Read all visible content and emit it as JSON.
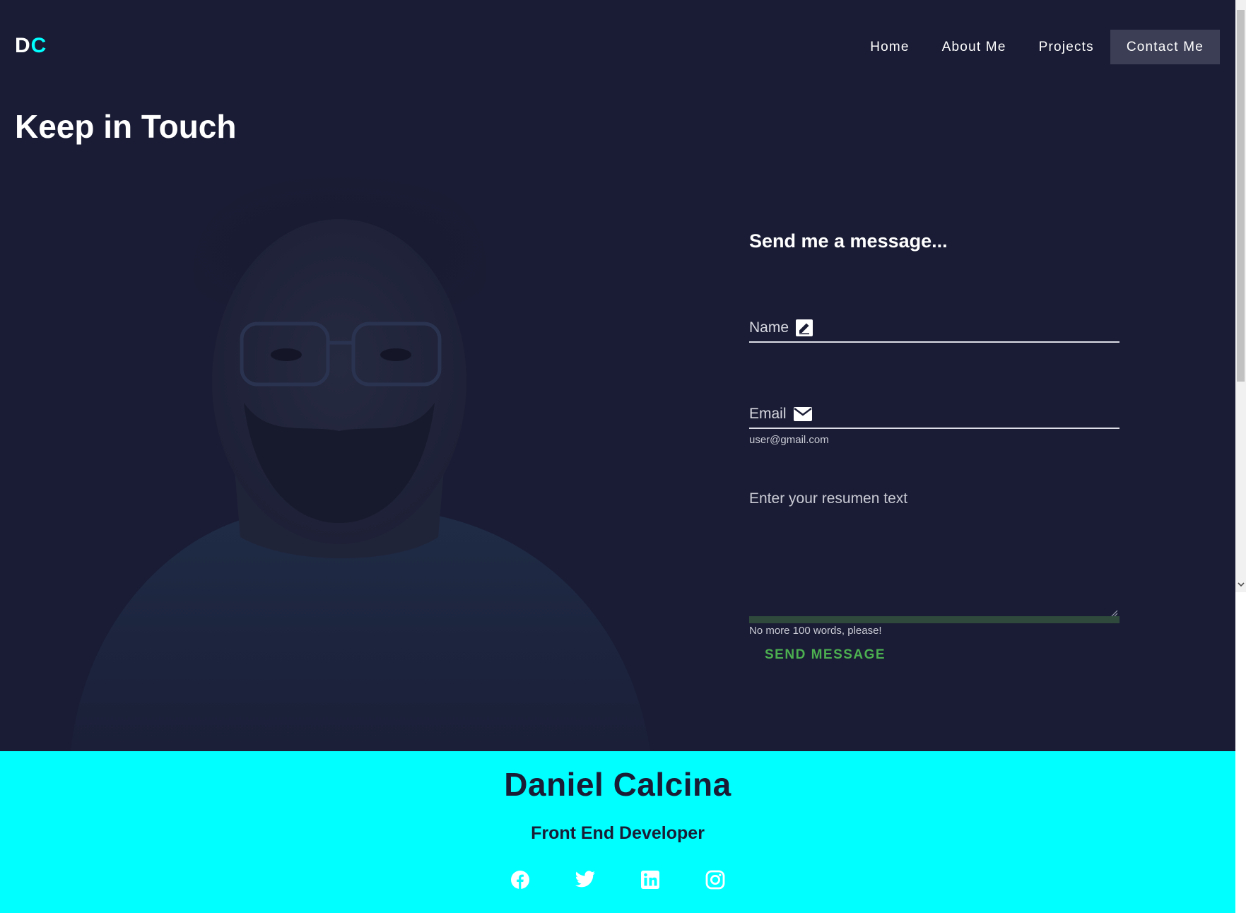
{
  "brand": {
    "first": "D",
    "second": "C"
  },
  "nav": {
    "items": [
      {
        "label": "Home"
      },
      {
        "label": "About Me"
      },
      {
        "label": "Projects"
      },
      {
        "label": "Contact Me",
        "active": true
      }
    ]
  },
  "page_title": "Keep in Touch",
  "form": {
    "title": "Send me a message...",
    "name_label": "Name",
    "name_icon": "edit-icon",
    "email_label": "Email",
    "email_icon": "mail-icon",
    "email_hint": "user@gmail.com",
    "message_label": "Enter your resumen text",
    "message_hint": "No more 100 words, please!",
    "send_label": "SEND MESSAGE"
  },
  "footer": {
    "name": "Daniel Calcina",
    "role": "Front End Developer",
    "socials": [
      "facebook-icon",
      "twitter-icon",
      "linkedin-icon",
      "instagram-icon"
    ]
  },
  "colors": {
    "background": "#1a1c35",
    "accent": "#00ffff",
    "button": "#4caf50",
    "nav_active": "#3b3e55"
  }
}
